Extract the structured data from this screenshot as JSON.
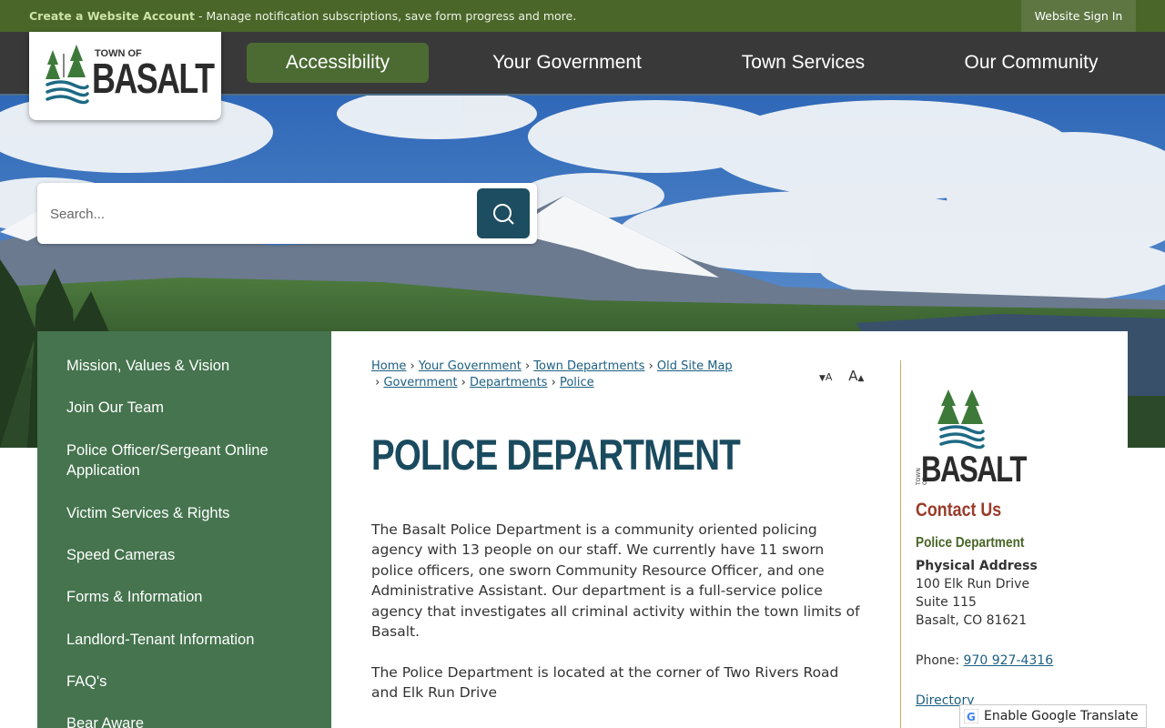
{
  "topbar": {
    "account_link": "Create a Website Account",
    "account_desc": " - Manage notification subscriptions, save form progress and more.",
    "signin": "Website Sign In"
  },
  "logo": {
    "town_of": "TOWN OF",
    "name": "BASALT"
  },
  "nav": [
    "Accessibility",
    "Your Government",
    "Town Services",
    "Our Community"
  ],
  "search": {
    "placeholder": "Search..."
  },
  "sidebar": [
    "Mission, Values & Vision",
    "Join Our Team",
    "Police Officer/Sergeant Online Application",
    "Victim Services & Rights",
    "Speed Cameras",
    "Forms & Information",
    "Landlord-Tenant Information",
    "FAQ's",
    "Bear Aware"
  ],
  "breadcrumb": [
    "Home",
    "Your Government",
    "Town Departments",
    "Old Site Map",
    "Government",
    "Departments",
    "Police"
  ],
  "font_controls": {
    "decrease": "A",
    "increase": "A"
  },
  "page_title": "POLICE DEPARTMENT",
  "paragraphs": [
    "The Basalt Police Department is a community oriented policing agency with 13 people on our staff. We currently have 11 sworn police officers, one sworn Community Resource Officer, and one Administrative Assistant. Our department is a full-service police agency that investigates all criminal activity within the town limits of Basalt.",
    "The Police Department is located at the corner of Two Rivers Road and Elk Run Drive"
  ],
  "contact": {
    "logo_small": "TOWN OF",
    "logo_name": "BASALT",
    "title": "Contact Us",
    "dept": "Police Department",
    "address_label": "Physical Address",
    "address": [
      "100 Elk Run Drive",
      "Suite 115",
      "Basalt, CO 81621"
    ],
    "phone_label": "Phone: ",
    "phone": "970 927-4316",
    "directory": "Directory"
  },
  "translate": "Enable Google Translate",
  "colors": {
    "topbar": "#4a6629",
    "nav": "#393939",
    "active_nav": "#4b6b33",
    "sidebar": "#45744e",
    "title": "#1a4a5e",
    "contact_title": "#9a3b2a"
  }
}
